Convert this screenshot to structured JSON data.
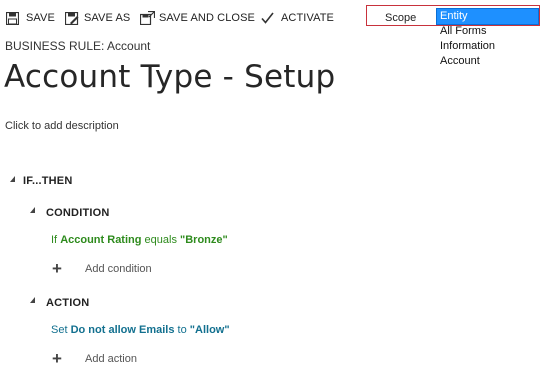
{
  "toolbar": {
    "save_label": "SAVE",
    "save_as_label": "SAVE AS",
    "save_close_label": "SAVE AND CLOSE",
    "activate_label": "ACTIVATE"
  },
  "scope": {
    "label": "Scope",
    "selected": "Entity",
    "options": [
      "Entity",
      "All Forms",
      "Information",
      "Account"
    ]
  },
  "header": {
    "breadcrumb": "BUSINESS RULE: Account",
    "title": "Account Type - Setup",
    "description_placeholder": "Click to add description"
  },
  "rule": {
    "root_label": "IF...THEN",
    "condition": {
      "heading": "CONDITION",
      "prefix": "If",
      "field": "Account Rating",
      "operator": "equals",
      "value": "\"Bronze\"",
      "add_label": "Add condition"
    },
    "action": {
      "heading": "ACTION",
      "prefix": "Set",
      "field": "Do not allow Emails",
      "operator": "to",
      "value": "\"Allow\"",
      "add_label": "Add action"
    }
  },
  "colors": {
    "condition_green": "#2e8b1d",
    "action_blue": "#12708f",
    "selection_blue": "#1e90ff",
    "highlight_red": "#c8323c"
  }
}
